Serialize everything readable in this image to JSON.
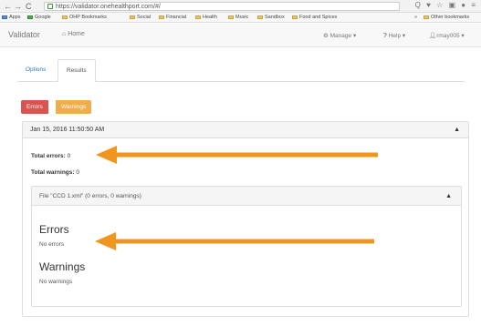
{
  "browser": {
    "nav_back": "←",
    "nav_forward": "→",
    "nav_reload": "C",
    "url": "https://validator.onehealthport.com/#/",
    "right_icons": "Q ♥ ☆ ▣ ● ≡"
  },
  "bookmarks": {
    "items": [
      "Apps",
      "Google",
      "OHP Bookmarks",
      "Social",
      "Financial",
      "Health",
      "Music",
      "Sandbox",
      "Food and Spices"
    ],
    "more": "»",
    "other": "Other bookmarks"
  },
  "navbar": {
    "brand": "Validator",
    "home": "Home",
    "manage": "Manage",
    "help": "Help",
    "user": "rmay005"
  },
  "tabs": [
    "Options",
    "Results"
  ],
  "filters": {
    "errors": "Errors",
    "warnings": "Warnings"
  },
  "panel": {
    "timestamp": "Jan 15, 2016 11:50:50 AM",
    "total_errors_label": "Total errors:",
    "total_errors_value": "0",
    "total_warnings_label": "Total warnings:",
    "total_warnings_value": "0"
  },
  "file_panel": {
    "title": "File \"CCD 1.xml\" (0 errors, 0 warnings)",
    "errors_heading": "Errors",
    "errors_text": "No errors",
    "warnings_heading": "Warnings",
    "warnings_text": "No warnings"
  },
  "colors": {
    "errors": "#d9534f",
    "warnings": "#f0ad4e",
    "arrow": "#f0961e",
    "link": "#337ab7"
  }
}
